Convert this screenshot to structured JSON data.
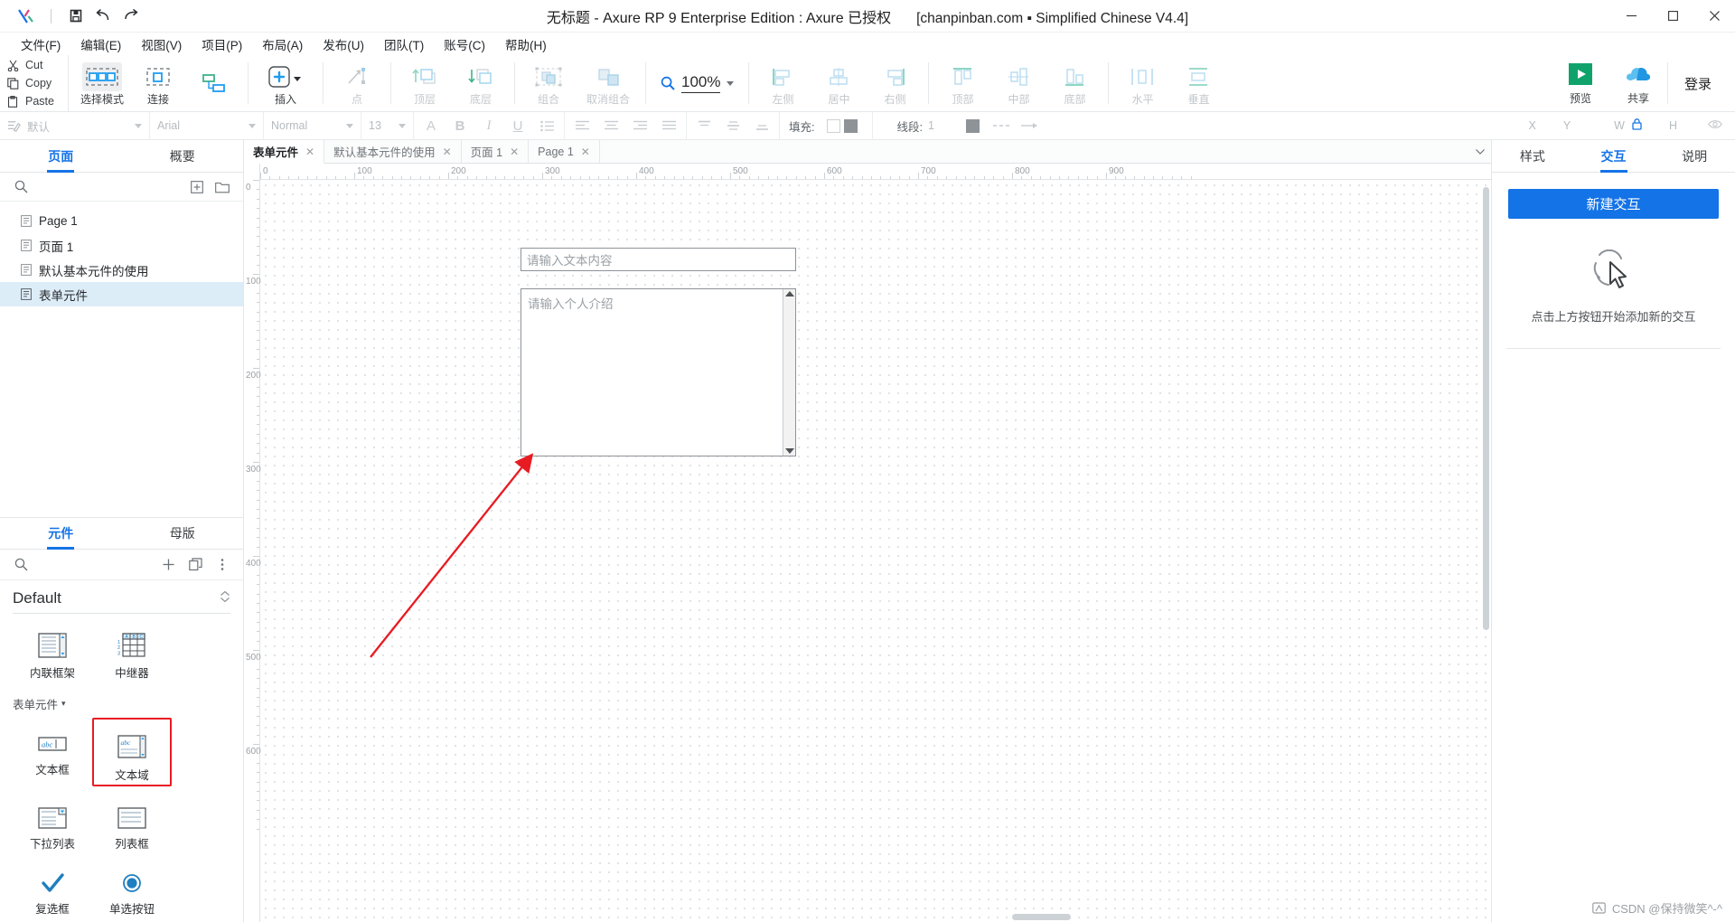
{
  "titlebar": {
    "title": "无标题 - Axure RP 9 Enterprise Edition : Axure 已授权",
    "subtitle": "[chanpinban.com ▪ Simplified Chinese V4.4]",
    "save_icon": "save-icon",
    "undo_icon": "undo-icon",
    "redo_icon": "redo-icon",
    "minimize": "—",
    "maximize": "▢",
    "close": "✕"
  },
  "menubar": {
    "items": [
      {
        "label": "文件(F)",
        "name": "menu-file"
      },
      {
        "label": "编辑(E)",
        "name": "menu-edit"
      },
      {
        "label": "视图(V)",
        "name": "menu-view"
      },
      {
        "label": "项目(P)",
        "name": "menu-project"
      },
      {
        "label": "布局(A)",
        "name": "menu-layout"
      },
      {
        "label": "发布(U)",
        "name": "menu-publish"
      },
      {
        "label": "团队(T)",
        "name": "menu-team"
      },
      {
        "label": "账号(C)",
        "name": "menu-account"
      },
      {
        "label": "帮助(H)",
        "name": "menu-help"
      }
    ]
  },
  "toolbar": {
    "clipboard": [
      {
        "label": "Cut",
        "name": "cut-button"
      },
      {
        "label": "Copy",
        "name": "copy-button"
      },
      {
        "label": "Paste",
        "name": "paste-button"
      }
    ],
    "buttons": [
      {
        "label": "选择模式",
        "name": "select-mode-button",
        "state": "selected"
      },
      {
        "label": "连接",
        "name": "connect-button",
        "state": "normal"
      },
      {
        "label": "插入",
        "name": "insert-button",
        "state": "normal"
      },
      {
        "label": "点",
        "name": "point-button",
        "state": "disabled"
      },
      {
        "label": "顶层",
        "name": "bring-to-front-button",
        "state": "disabled"
      },
      {
        "label": "底层",
        "name": "send-to-back-button",
        "state": "disabled"
      },
      {
        "label": "组合",
        "name": "group-button",
        "state": "disabled"
      },
      {
        "label": "取消组合",
        "name": "ungroup-button",
        "state": "disabled"
      },
      {
        "label": "左侧",
        "name": "align-left-button",
        "state": "disabled"
      },
      {
        "label": "居中",
        "name": "align-center-button",
        "state": "disabled"
      },
      {
        "label": "右侧",
        "name": "align-right-button",
        "state": "disabled"
      },
      {
        "label": "顶部",
        "name": "align-top-button",
        "state": "disabled"
      },
      {
        "label": "中部",
        "name": "align-middle-button",
        "state": "disabled"
      },
      {
        "label": "底部",
        "name": "align-bottom-button",
        "state": "disabled"
      },
      {
        "label": "水平",
        "name": "distribute-horizontal-button",
        "state": "disabled"
      },
      {
        "label": "垂直",
        "name": "distribute-vertical-button",
        "state": "disabled"
      }
    ],
    "zoom": "100%",
    "preview_label": "预览",
    "share_label": "共享",
    "login_label": "登录"
  },
  "formatbar": {
    "style": "默认",
    "font": "Arial",
    "weight": "Normal",
    "size": "13",
    "fill_label": "填充:",
    "line_label": "线段:",
    "line_width": "1",
    "x_label": "X",
    "y_label": "Y",
    "w_label": "W",
    "h_label": "H",
    "lock_icon": "lock-icon",
    "eye_icon": "eye-icon"
  },
  "left_panel": {
    "tabs": [
      {
        "label": "页面",
        "name": "tab-pages",
        "active": true
      },
      {
        "label": "概要",
        "name": "tab-outline",
        "active": false
      }
    ],
    "search_placeholder": "",
    "add_page_icon": "add-page-icon",
    "add_folder_icon": "add-folder-icon",
    "pages": [
      {
        "label": "Page 1",
        "name": "page-item-page1",
        "selected": false
      },
      {
        "label": "页面 1",
        "name": "page-item-yemian1",
        "selected": false
      },
      {
        "label": "默认基本元件的使用",
        "name": "page-item-default-widgets",
        "selected": false
      },
      {
        "label": "表单元件",
        "name": "page-item-form-widgets",
        "selected": true
      }
    ],
    "library": {
      "tabs": [
        {
          "label": "元件",
          "name": "tab-widgets",
          "active": true
        },
        {
          "label": "母版",
          "name": "tab-masters",
          "active": false
        }
      ],
      "add_icon": "plus-icon",
      "copy_icon": "duplicate-icon",
      "more_icon": "more-options-icon",
      "group_title": "Default",
      "collapse_icon": "collapse-icon",
      "default_widgets": [
        {
          "label": "内联框架",
          "name": "widget-inline-frame"
        },
        {
          "label": "中继器",
          "name": "widget-repeater"
        }
      ],
      "form_section_label": "表单元件",
      "form_widgets": [
        {
          "label": "文本框",
          "name": "widget-text-field",
          "highlight": false
        },
        {
          "label": "文本域",
          "name": "widget-text-area",
          "highlight": true
        },
        {
          "label": "下拉列表",
          "name": "widget-droplist",
          "highlight": false
        },
        {
          "label": "列表框",
          "name": "widget-list-box",
          "highlight": false
        },
        {
          "label": "复选框",
          "name": "widget-checkbox",
          "highlight": false
        },
        {
          "label": "单选按钮",
          "name": "widget-radio-button",
          "highlight": false
        }
      ]
    }
  },
  "canvas": {
    "doc_tabs": [
      {
        "label": "表单元件",
        "name": "doc-tab-form-widgets",
        "active": true
      },
      {
        "label": "默认基本元件的使用",
        "name": "doc-tab-default-widgets",
        "active": false
      },
      {
        "label": "页面 1",
        "name": "doc-tab-yemian1",
        "active": false
      },
      {
        "label": "Page 1",
        "name": "doc-tab-page1",
        "active": false
      }
    ],
    "close_glyph": "✕",
    "ruler_h_labels": [
      "0",
      "100",
      "200",
      "300",
      "400",
      "500",
      "600",
      "700",
      "800",
      "900"
    ],
    "ruler_v_labels": [
      "0",
      "100",
      "200",
      "300",
      "400",
      "500",
      "600"
    ],
    "widgets_on_canvas": [
      {
        "name": "canvas-text-field",
        "placeholder": "请输入文本内容",
        "type": "text-field"
      },
      {
        "name": "canvas-text-area",
        "placeholder": "请输入个人介绍",
        "type": "text-area"
      }
    ]
  },
  "right_panel": {
    "tabs": [
      {
        "label": "样式",
        "name": "tab-style",
        "active": false
      },
      {
        "label": "交互",
        "name": "tab-interactions",
        "active": true
      },
      {
        "label": "说明",
        "name": "tab-notes",
        "active": false
      }
    ],
    "new_interaction_label": "新建交互",
    "empty_icon": "click-cursor-icon",
    "empty_hint": "点击上方按钮开始添加新的交互"
  },
  "watermark": {
    "text": "CSDN @保持微笑^-^",
    "icon": "csdn-watermark-icon"
  },
  "colors": {
    "accent": "#1473e6",
    "annotation_red": "#e81b23",
    "selection_blue": "#ddedf8",
    "panel_border": "#e3e6e9",
    "preview_green": "#0fa36b",
    "share_blue": "#1fa0e8"
  }
}
